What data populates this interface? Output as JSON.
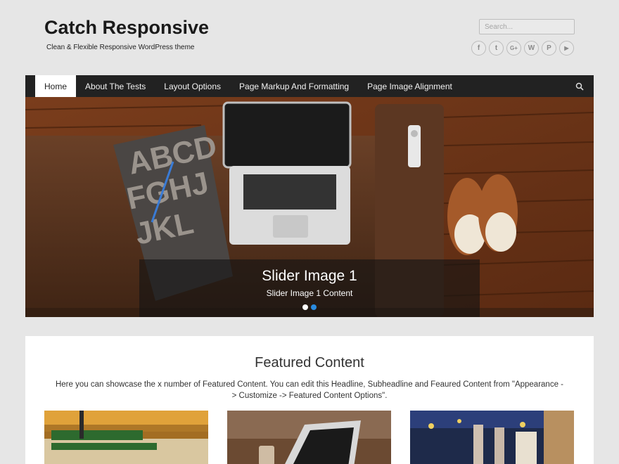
{
  "header": {
    "site_title": "Catch Responsive",
    "site_description": "Clean & Flexible Responsive WordPress theme",
    "search_placeholder": "Search..."
  },
  "social": [
    {
      "icon": "facebook-icon",
      "glyph": "f"
    },
    {
      "icon": "twitter-icon",
      "glyph": "t"
    },
    {
      "icon": "google-plus-icon",
      "glyph": "G+"
    },
    {
      "icon": "wordpress-icon",
      "glyph": "W"
    },
    {
      "icon": "pinterest-icon",
      "glyph": "P"
    },
    {
      "icon": "youtube-icon",
      "glyph": "▶"
    }
  ],
  "nav": {
    "items": [
      {
        "label": "Home"
      },
      {
        "label": "About The Tests"
      },
      {
        "label": "Layout Options"
      },
      {
        "label": "Page Markup And Formatting"
      },
      {
        "label": "Page Image Alignment"
      }
    ],
    "active_index": 0,
    "search_icon": "search-icon"
  },
  "slider": {
    "title": "Slider Image 1",
    "content": "Slider Image 1 Content",
    "slide_count": 2,
    "active_slide": 0
  },
  "featured": {
    "title": "Featured Content",
    "description": "Here you can showcase the x number of Featured Content. You can edit this Headline, Subheadline and Feaured Content from \"Appearance -> Customize -> Featured Content Options\"."
  },
  "colors": {
    "nav_bg": "#222222",
    "dot_active": "#ffffff",
    "dot_inactive": "#2a8be0"
  }
}
